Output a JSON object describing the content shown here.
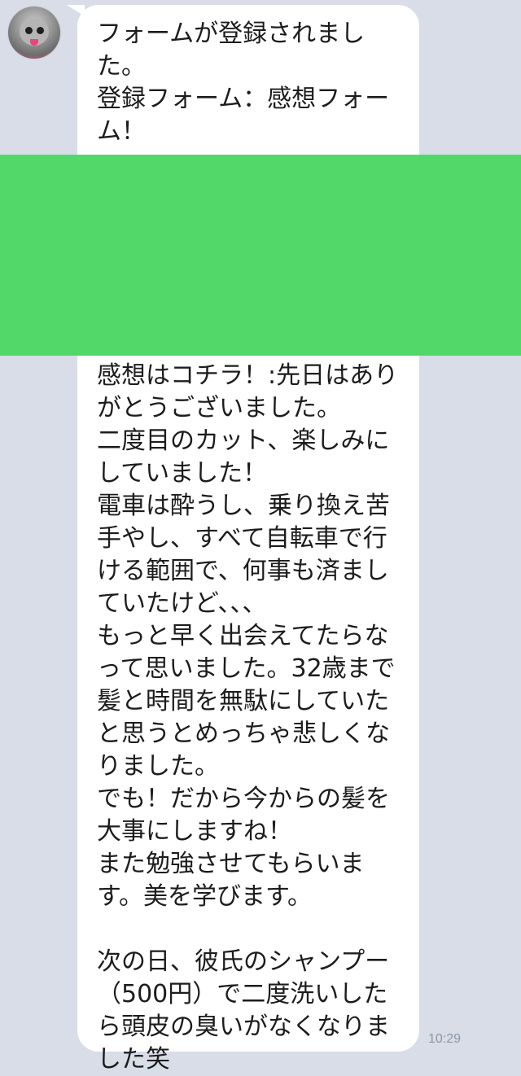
{
  "chat": {
    "avatar_icon": "dog-avatar-icon",
    "message_top": "フォームが登録されました。\n登録フォーム：感想フォーム！",
    "message_body": "感想はコチラ！:先日はありがとうございました。\n二度目のカット、楽しみにしていました！\n電車は酔うし、乗り換え苦手やし、すべて自転車で行ける範囲で、何事も済ましていたけど、、、\nもっと早く出会えてたらなって思いました。32歳まで髪と時間を無駄にしていたと思うとめっちゃ悲しくなりました。\nでも！だから今からの髪を大事にしますね！\nまた勉強させてもらいます。美を学びます。\n\n次の日、彼氏のシャンプー（500円）で二度洗いしたら頭皮の臭いがなくなりました笑",
    "timestamp": "10:29"
  },
  "colors": {
    "background": "#d8dde7",
    "bubble": "#ffffff",
    "redaction": "#52d869",
    "text": "#1c1c1c",
    "timestamp": "#8c96a6"
  }
}
